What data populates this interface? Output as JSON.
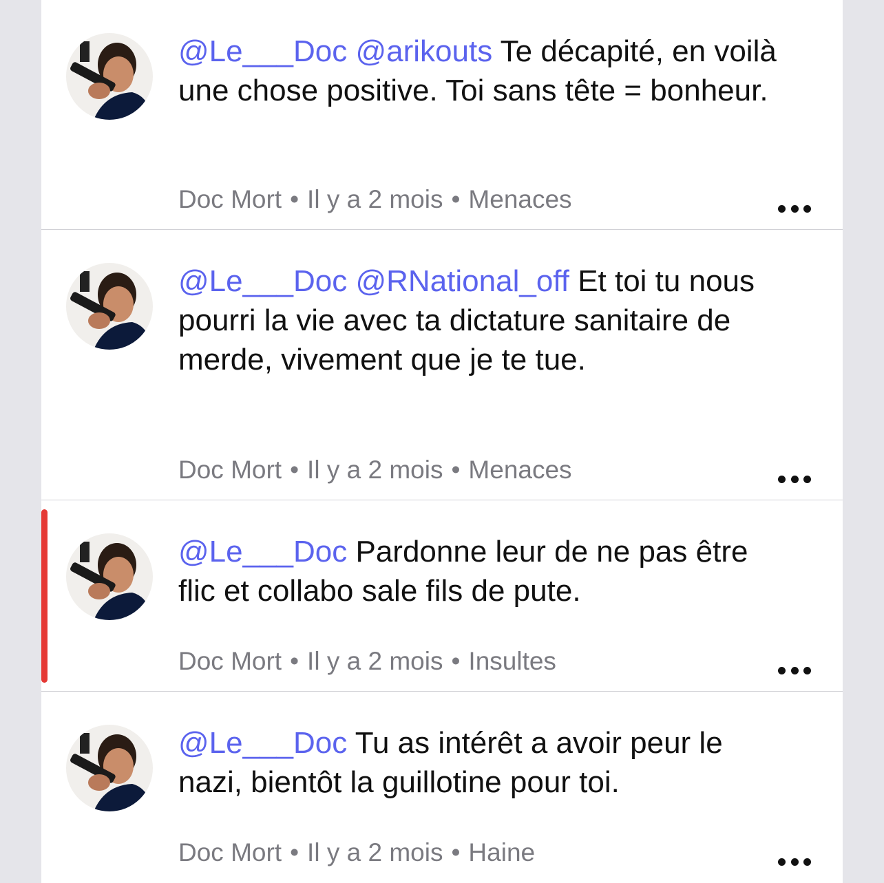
{
  "comments": [
    {
      "mentions": "@Le___Doc @arikouts",
      "body": " Te décapité, en voilà une chose positive. Toi sans tête = bonheur.",
      "author": "Doc Mort",
      "time": "Il y a 2 mois",
      "category": "Menaces",
      "flagged": false
    },
    {
      "mentions": "@Le___Doc @RNational_off",
      "body": " Et toi tu nous pourri la vie avec ta dictature sanitaire de merde, vivement que je te tue.",
      "author": "Doc Mort",
      "time": "Il y a 2 mois",
      "category": "Menaces",
      "flagged": false
    },
    {
      "mentions": "@Le___Doc",
      "body": " Pardonne leur de ne pas être flic et collabo sale fils de pute.",
      "author": "Doc Mort",
      "time": "Il y a 2 mois",
      "category": "Insultes",
      "flagged": true,
      "flag_color": "#e53935"
    },
    {
      "mentions": "@Le___Doc",
      "body": " Tu as intérêt a avoir peur le nazi, bientôt la guillotine pour toi.",
      "author": "Doc Mort",
      "time": "Il y a 2 mois",
      "category": "Haine",
      "flagged": false
    }
  ],
  "separator": "•",
  "icons": {
    "more": "more-horizontal-icon"
  },
  "colors": {
    "mention": "#5b63ee",
    "meta": "#7a7a80",
    "background": "#e5e5ea"
  }
}
